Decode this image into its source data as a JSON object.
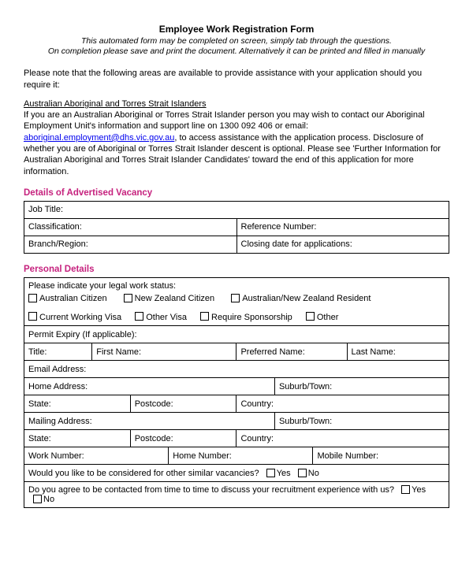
{
  "header": {
    "title": "Employee Work Registration Form",
    "subtitle1": "This automated form may be completed on screen, simply tab through the questions.",
    "subtitle2": "On completion please save and print the document.  Alternatively it can be printed and filled in manually"
  },
  "intro": {
    "assist_note": "Please note that the following areas are available to provide assistance with your application should you require it:",
    "atsi_heading": "Australian Aboriginal and Torres Strait Islanders",
    "atsi_line1": "If you are an Australian Aboriginal or Torres Strait Islander person you may wish to contact our Aboriginal Employment Unit's information and support line on 1300 092 406 or email:",
    "atsi_email": "aboriginal.employment@dhs.vic.gov.au",
    "atsi_line2": ", to access assistance with the application process. Disclosure of whether you are of Aboriginal or Torres Strait Islander descent is optional. Please see 'Further Information for Australian Aboriginal and Torres Strait Islander Candidates' toward the end of this application for more information."
  },
  "vacancy": {
    "heading": "Details of Advertised Vacancy",
    "job_title": "Job Title:",
    "classification": "Classification:",
    "reference": "Reference Number:",
    "branch": "Branch/Region:",
    "closing": "Closing date for applications:"
  },
  "personal": {
    "heading": "Personal Details",
    "legal_status": "Please indicate your legal work status:",
    "opts": {
      "aus": "Australian Citizen",
      "nz": "New Zealand Citizen",
      "anzres": "Australian/New Zealand Resident",
      "cwv": "Current Working Visa",
      "ov": "Other Visa",
      "spon": "Require Sponsorship",
      "other": "Other"
    },
    "permit": "Permit Expiry (If applicable):",
    "title_lbl": "Title:",
    "fname": "First Name:",
    "pname": "Preferred Name:",
    "lname": "Last Name:",
    "email": "Email Address:",
    "home_addr": "Home Address:",
    "suburb": "Suburb/Town:",
    "state": "State:",
    "postcode": "Postcode:",
    "country": "Country:",
    "mail_addr": "Mailing Address:",
    "work_no": "Work Number:",
    "home_no": "Home Number:",
    "mobile_no": "Mobile Number:",
    "similar_q": "Would you like to be considered for other similar vacancies?",
    "contact_q": "Do you agree to be contacted from time to time to discuss your recruitment experience with us?",
    "yes": "Yes",
    "no": "No"
  }
}
